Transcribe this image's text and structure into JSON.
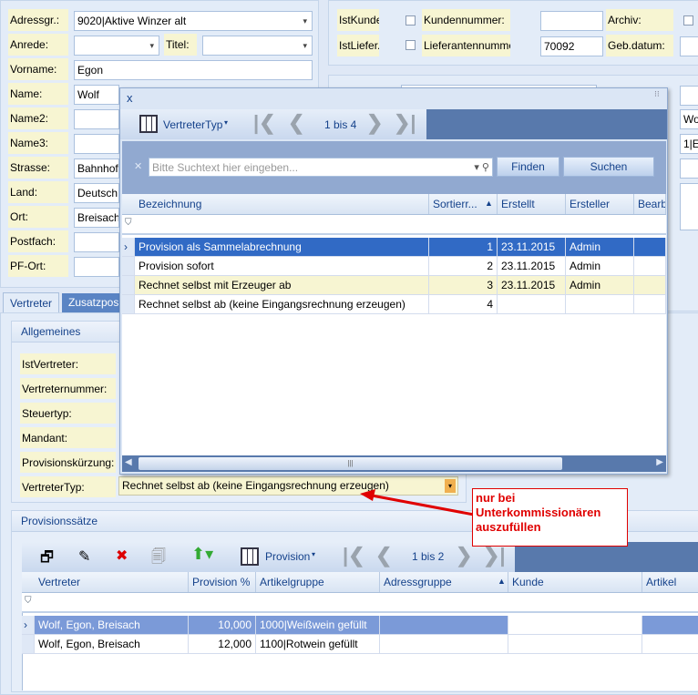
{
  "address": {
    "fields": [
      {
        "label": "Adressgr.:",
        "value": "9020|Aktive Winzer alt"
      },
      {
        "label": "Anrede:",
        "value": ""
      },
      {
        "label": "Vorname:",
        "value": "Egon"
      },
      {
        "label": "Name:",
        "value": "Wolf"
      },
      {
        "label": "Name2:",
        "value": ""
      },
      {
        "label": "Name3:",
        "value": ""
      },
      {
        "label": "Strasse:",
        "value": "Bahnhof"
      },
      {
        "label": "Land:",
        "value": "Deutsch"
      },
      {
        "label": "Ort:",
        "value": "Breisach"
      },
      {
        "label": "Postfach:",
        "value": ""
      },
      {
        "label": "PF-Ort:",
        "value": ""
      }
    ],
    "titel_label": "Titel:",
    "titel_value": ""
  },
  "flags": {
    "istkunde": "IstKunde:",
    "istliefer": "IstLiefer.:",
    "kundennummer_label": "Kundennummer:",
    "kundennummer": "",
    "lieferantennummer_label": "Lieferantennummer:",
    "lieferantennummer": "70092",
    "archiv": "Archiv:",
    "gebdatum": "Geb.datum:"
  },
  "right_partial": {
    "v1": "Wo",
    "v2": "1|E"
  },
  "tabs": [
    {
      "label": "Vertreter",
      "active": true
    },
    {
      "label": "Zusatzpos"
    }
  ],
  "allgemeines": {
    "title": "Allgemeines",
    "labels": [
      "IstVertreter:",
      "Vertreternummer:",
      "Steuertyp:",
      "Mandant:",
      "Provisionskürzung:",
      "VertreterTyp:"
    ],
    "vertretertyp_value": "Rechnet selbst ab (keine Eingangsrechnung erzeugen)"
  },
  "popup": {
    "close": "x",
    "layout_label": "VertreterTyp",
    "page_info": "1 bis 4",
    "search_placeholder": "Bitte Suchtext hier eingeben...",
    "find_label": "Finden",
    "search_label": "Suchen",
    "columns": [
      "Bezeichnung",
      "Sortierr...",
      "Erstellt",
      "Ersteller",
      "Bearb"
    ],
    "rows": [
      {
        "bez": "Provision als Sammelabrechnung",
        "sort": "1",
        "erstellt": "23.11.2015",
        "ersteller": "Admin",
        "selected": true
      },
      {
        "bez": "Provision sofort",
        "sort": "2",
        "erstellt": "23.11.2015",
        "ersteller": "Admin"
      },
      {
        "bez": "Rechnet selbst mit Erzeuger ab",
        "sort": "3",
        "erstellt": "23.11.2015",
        "ersteller": "Admin"
      },
      {
        "bez": "Rechnet selbst ab (keine Eingangsrechnung erzeugen)",
        "sort": "4",
        "erstellt": "",
        "ersteller": ""
      }
    ]
  },
  "annotation": {
    "text": "nur bei Unterkommissionären auszufüllen",
    "color": "#e00000"
  },
  "provision": {
    "title": "Provisionssätze",
    "layout_label": "Provision",
    "page_info": "1 bis 2",
    "columns": [
      "Vertreter",
      "Provision %",
      "Artikelgruppe",
      "Adressgruppe",
      "Kunde",
      "Artikel"
    ],
    "rows": [
      {
        "vertreter": "Wolf, Egon, Breisach",
        "prov": "10,000",
        "artikelgruppe": "1000|Weißwein gefüllt",
        "selected": true
      },
      {
        "vertreter": "Wolf, Egon, Breisach",
        "prov": "12,000",
        "artikelgruppe": "1100|Rotwein gefüllt"
      }
    ]
  }
}
